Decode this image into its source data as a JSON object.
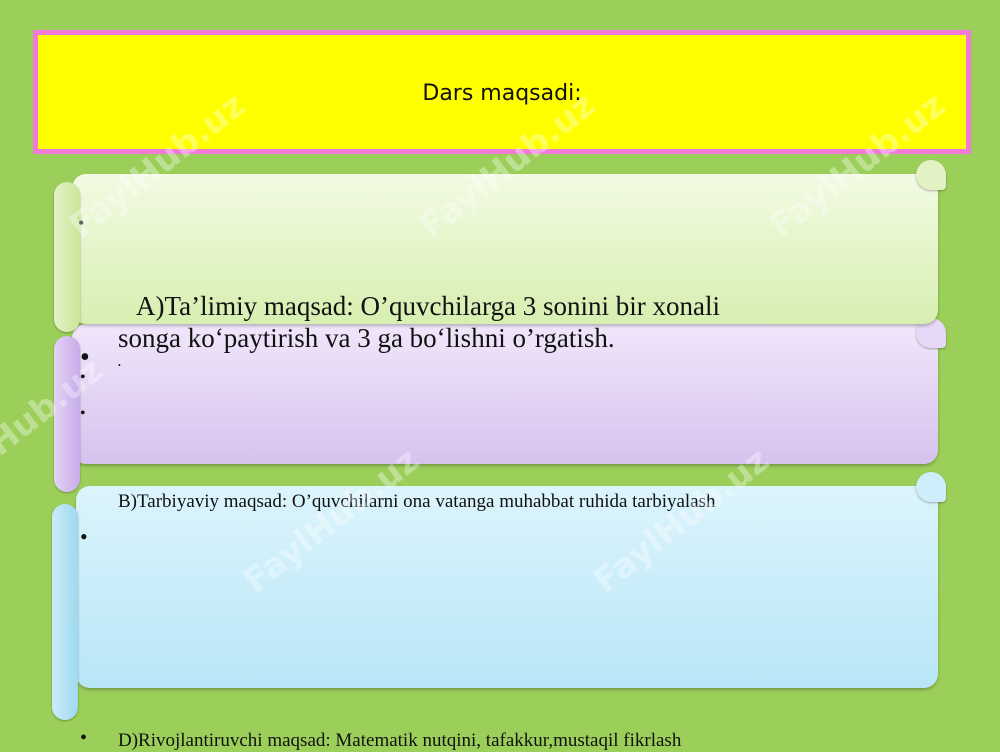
{
  "title": "Dars  maqsadi:",
  "watermark": "FaylHub.uz",
  "items": {
    "a_line1": "A)Ta’limiy  maqsad: O’quvchilarga  3 sonini bir xonali",
    "a_line2": "songa  ko‘paytirish va 3 ga bo‘lishni o’rgatish.",
    "b_text": "B)Tarbiyaviy   maqsad: O’quvchilarni ona vatanga muhabbat ruhida tarbiyalash",
    "d_text": "D)Rivojlantiruvchi   maqsad:  Matematik  nutqini, tafakkur,mustaqil fikrlash"
  },
  "bullet": "•",
  "colors": {
    "background": "#9ccf5a",
    "title_fill": "#ffff00",
    "title_border": "#f07ad8",
    "scroll_green": "#dff2bf",
    "scroll_purple": "#e2d2f3",
    "scroll_blue": "#c8ebf8"
  }
}
